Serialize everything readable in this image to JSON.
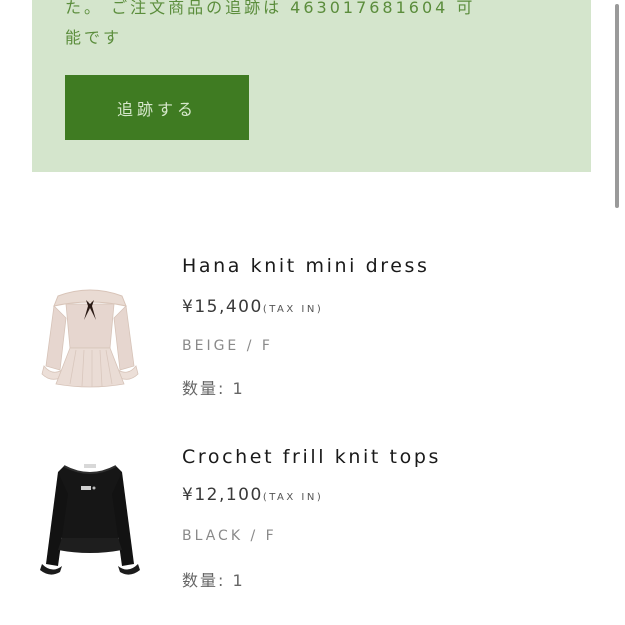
{
  "tracking": {
    "message_line1": "た。 ご注文商品の追跡は 463017681604 可",
    "message_line2": "能です",
    "button_label": "追跡する"
  },
  "items": [
    {
      "name": "Hana knit mini dress",
      "price": "¥15,400",
      "tax_note": "(TAX IN)",
      "variant": "BEIGE / F",
      "quantity": "数量: 1",
      "image_icon": "beige-off-shoulder-knit-dress",
      "image_color": "#e6d6cf"
    },
    {
      "name": "Crochet frill knit tops",
      "price": "¥12,100",
      "tax_note": "(TAX IN)",
      "variant": "BLACK / F",
      "quantity": "数量: 1",
      "image_icon": "black-long-sleeve-knit-top",
      "image_color": "#141414"
    }
  ],
  "colors": {
    "panel_bg": "#d4e5cc",
    "panel_text": "#5b8d3c",
    "button_bg": "#3f7b22",
    "button_text": "#d6e8cb"
  }
}
